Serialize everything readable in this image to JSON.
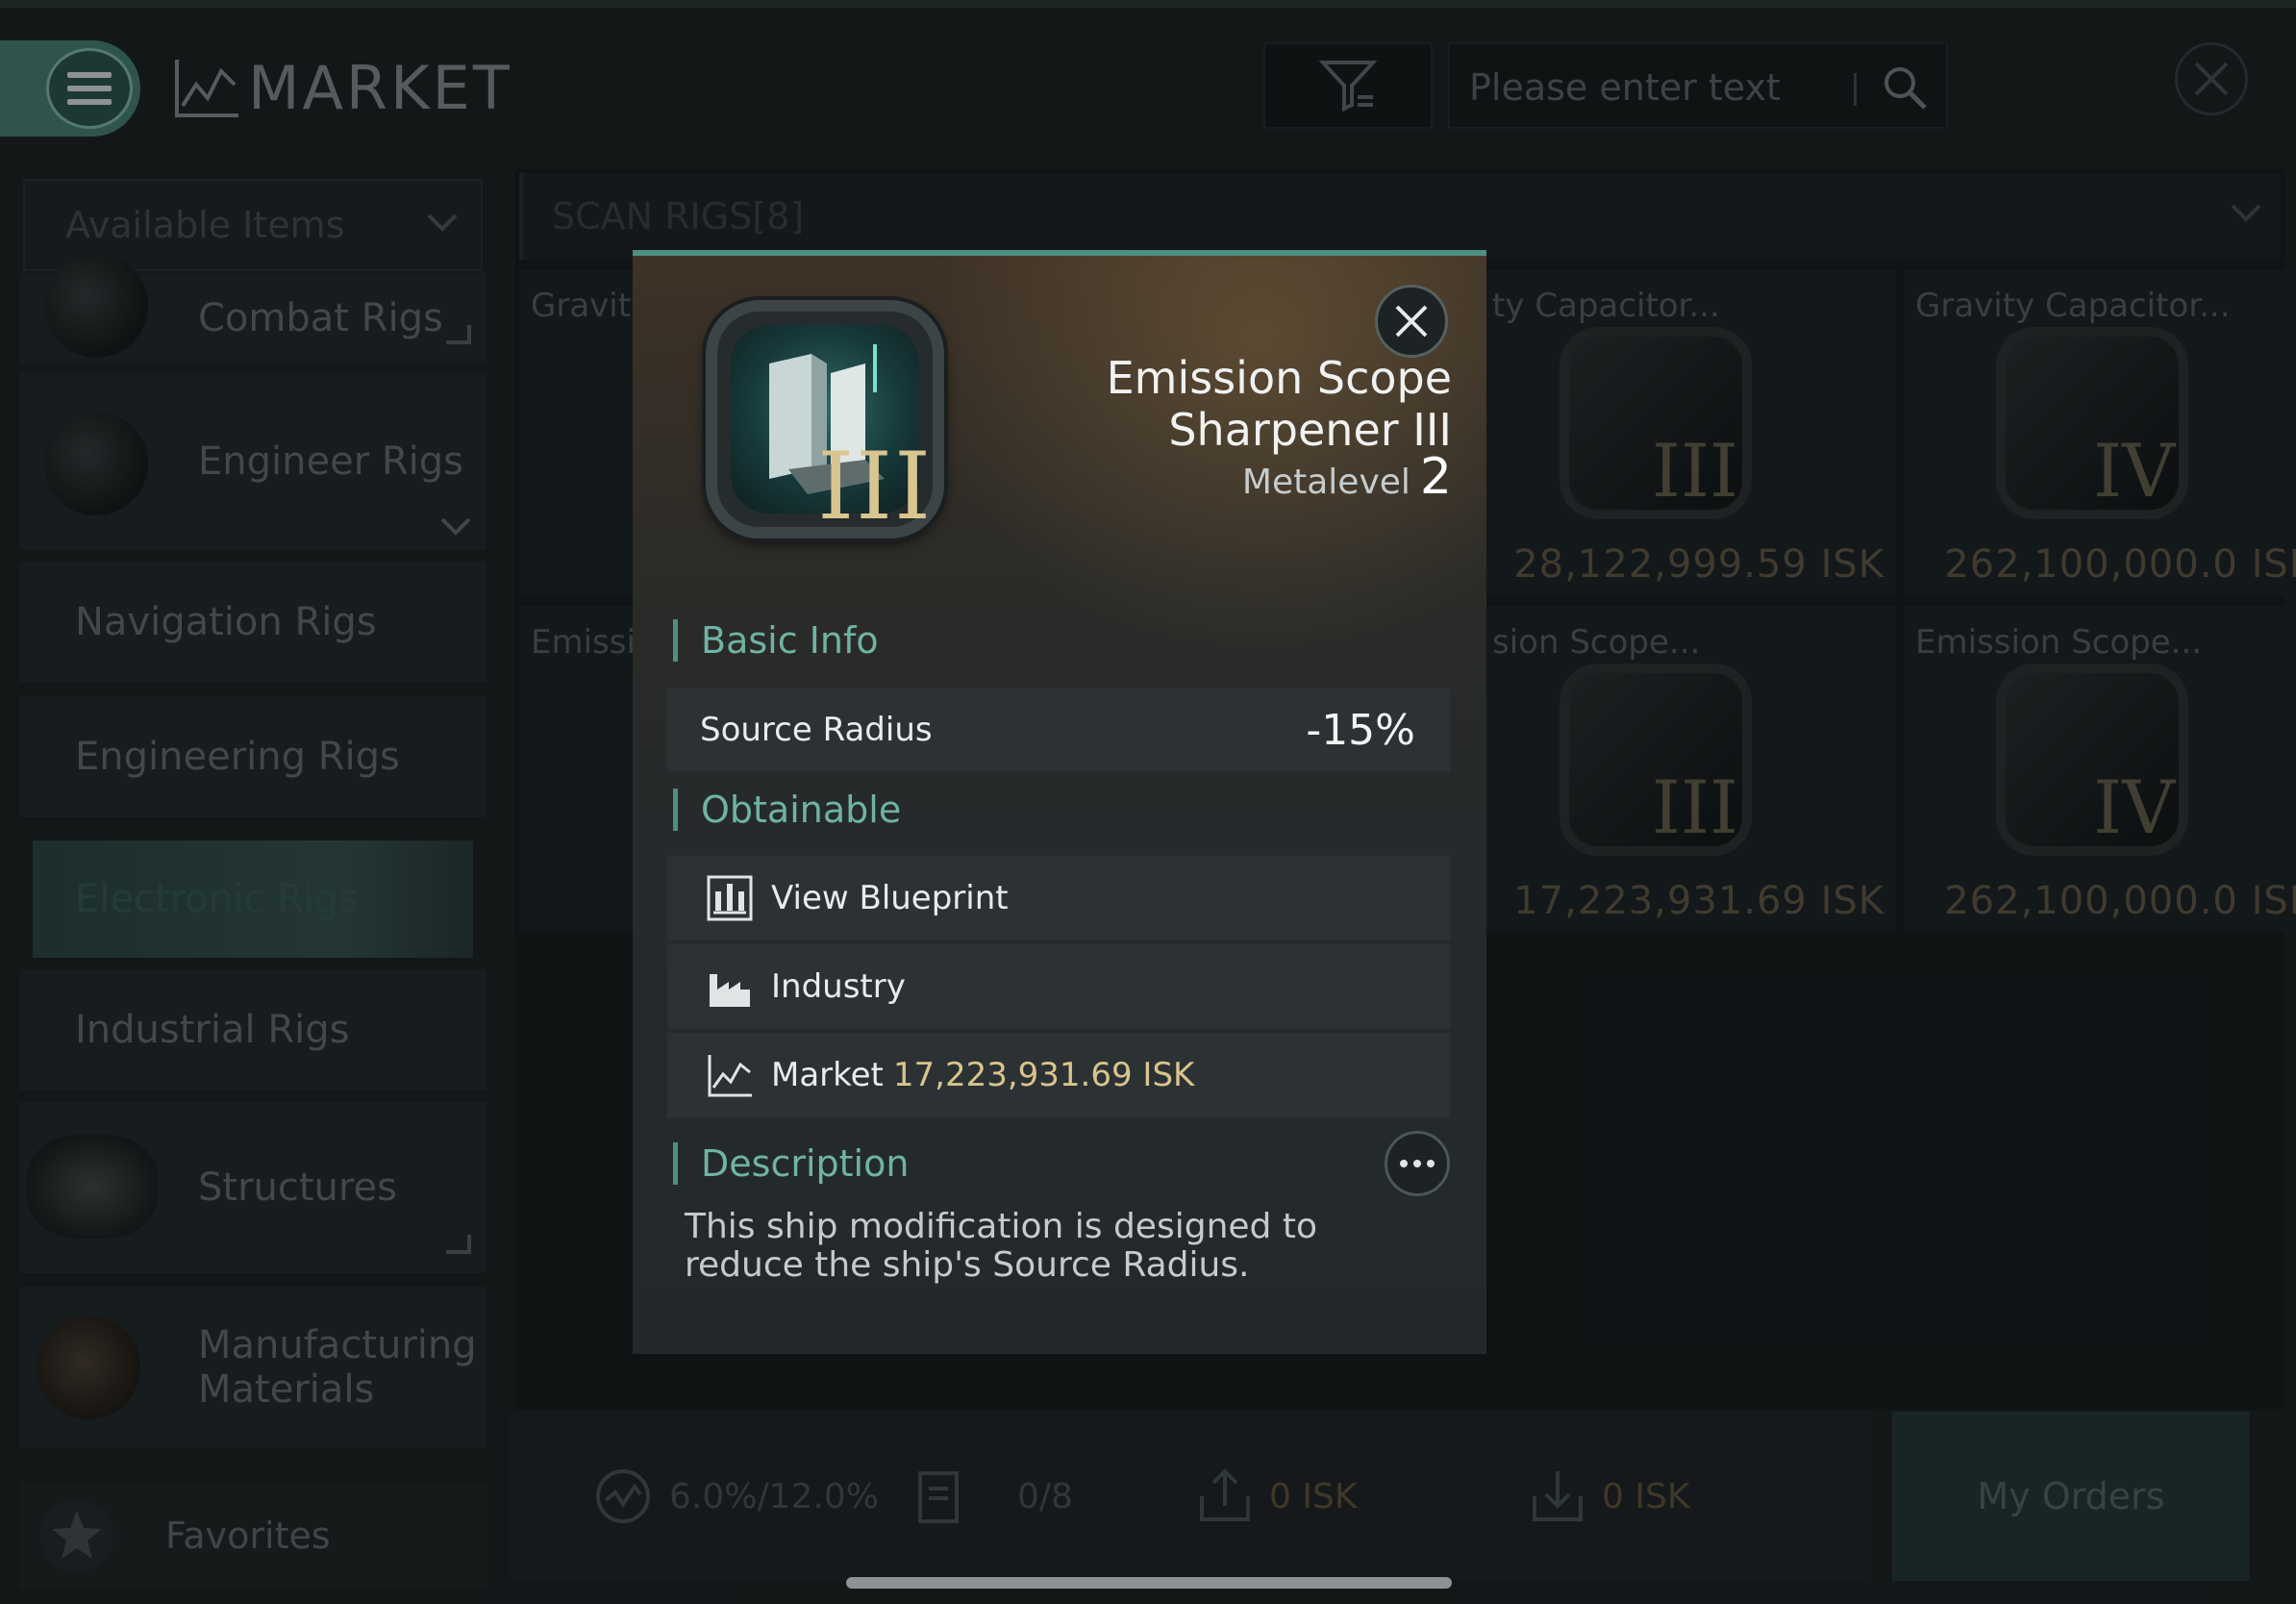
{
  "header": {
    "title": "MARKET",
    "search_placeholder": "Please enter text"
  },
  "sidebar": {
    "dropdown_label": "Available Items",
    "items": [
      {
        "label": "Combat Rigs"
      },
      {
        "label": "Engineer Rigs"
      },
      {
        "label": "Navigation Rigs"
      },
      {
        "label": "Engineering Rigs"
      },
      {
        "label": "Electronic Rigs",
        "active": true
      },
      {
        "label": "Industrial Rigs"
      },
      {
        "label": "Structures"
      },
      {
        "label": "Manufacturing\nMaterials"
      }
    ],
    "favorites_label": "Favorites"
  },
  "content": {
    "section_label": "SCAN RIGS[8]",
    "cards": [
      {
        "name": "Gravity",
        "price": "",
        "tier": ""
      },
      {
        "name": "ty Capacitor...",
        "price": "28,122,999.59 ISK",
        "tier": "III"
      },
      {
        "name": "Gravity Capacitor...",
        "price": "262,100,000.0 ISK",
        "tier": "IV"
      },
      {
        "name": "Emissic",
        "price": "",
        "tier": ""
      },
      {
        "name": "sion Scope...",
        "price": "17,223,931.69 ISK",
        "tier": "III"
      },
      {
        "name": "Emission Scope...",
        "price": "262,100,000.0 ISK",
        "tier": "IV"
      }
    ]
  },
  "bottom_bar": {
    "tax": "6.0%/12.0%",
    "orders_count": "0/8",
    "sell_isk": "0 ISK",
    "buy_isk": "0 ISK",
    "my_orders_label": "My Orders"
  },
  "modal": {
    "name": "Emission Scope Sharpener III",
    "tier": "III",
    "metalevel_label": "Metalevel",
    "metalevel_value": "2",
    "basic_info_label": "Basic Info",
    "source_radius_label": "Source Radius",
    "source_radius_value": "-15%",
    "obtainable_label": "Obtainable",
    "view_blueprint_label": "View Blueprint",
    "industry_label": "Industry",
    "market_label": "Market",
    "market_price": "17,223,931.69 ISK",
    "description_label": "Description",
    "description_text": "This ship modification is designed to reduce the ship's Source Radius."
  },
  "colors": {
    "accent": "#4e8f84",
    "section_text": "#6fb3a5",
    "isk_gold": "#d8c58d"
  }
}
